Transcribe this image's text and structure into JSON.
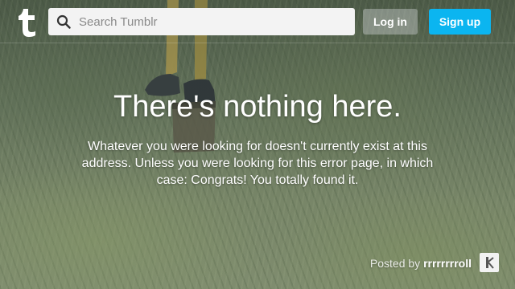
{
  "header": {
    "logo_letter": "t",
    "search": {
      "placeholder": "Search Tumblr",
      "value": ""
    },
    "login_label": "Log in",
    "signup_label": "Sign up"
  },
  "main": {
    "title": "There's nothing here.",
    "description": "Whatever you were looking for doesn't currently exist at this address. Unless you were looking for this error page, in which case: Congrats! You totally found it."
  },
  "credit": {
    "prefix": "Posted by",
    "author": "rrrrrrrroll"
  },
  "colors": {
    "signup": "#0bb5f0",
    "login": "#c8cdcd",
    "search_bg": "#f3f3f3"
  },
  "icons": {
    "logo": "tumblr-logo-icon",
    "search": "search-icon",
    "avatar": "author-avatar-icon"
  }
}
